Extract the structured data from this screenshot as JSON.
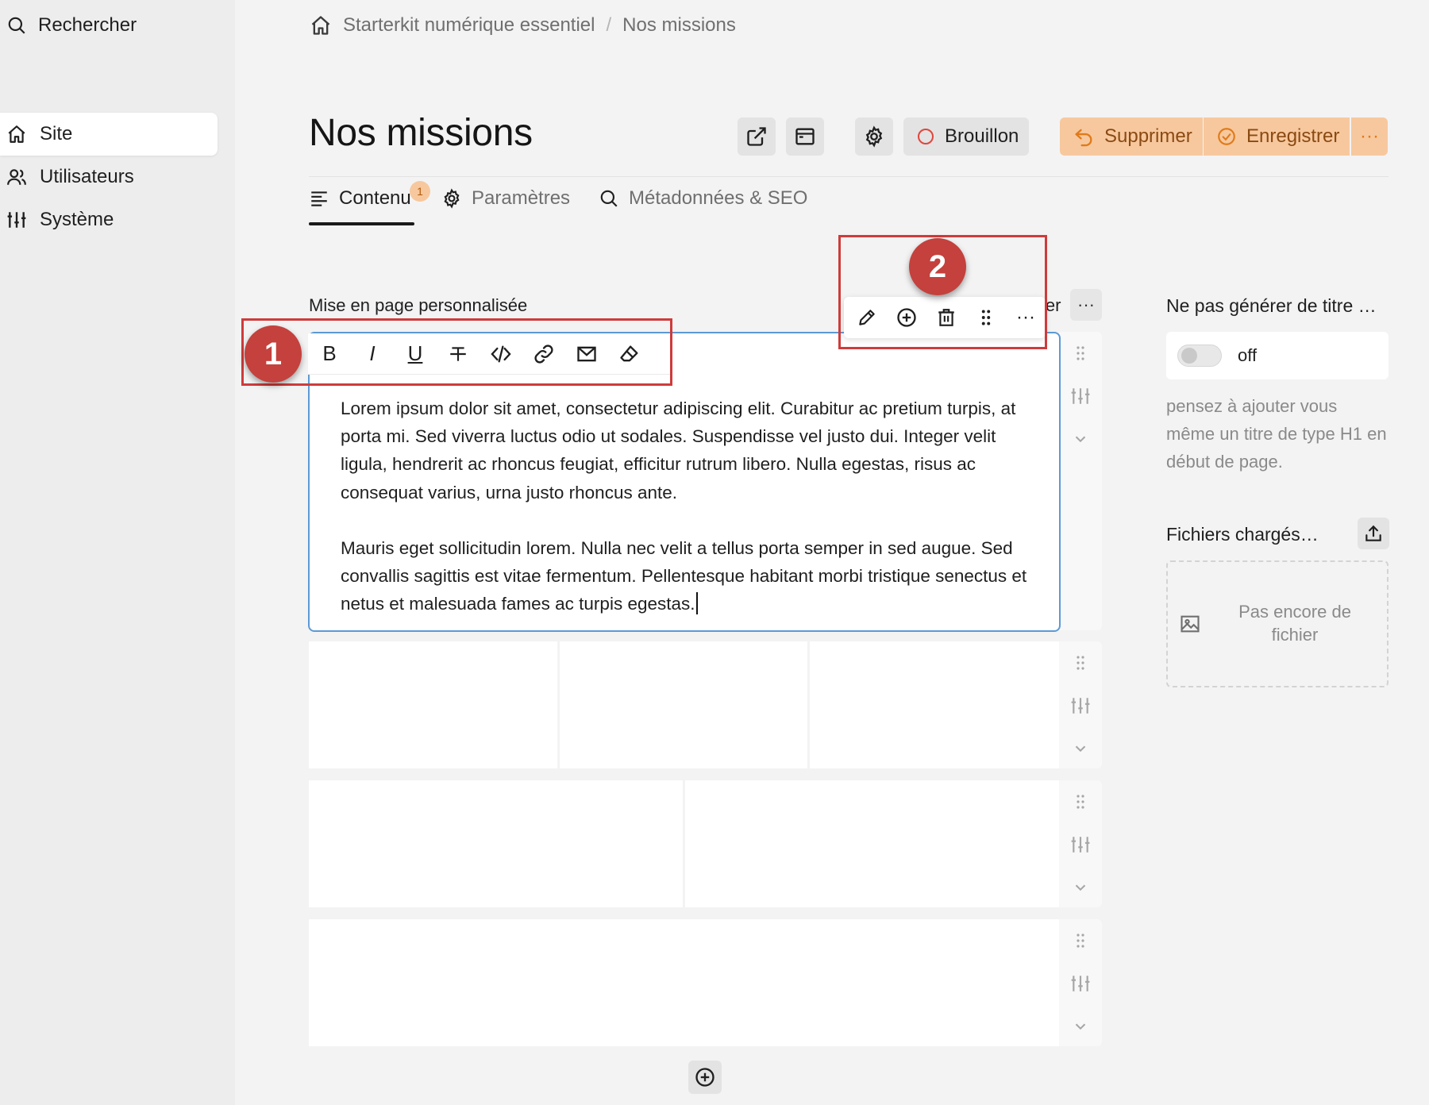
{
  "sidebar": {
    "search_label": "Rechercher",
    "items": [
      {
        "label": "Site",
        "icon": "home-icon",
        "active": true
      },
      {
        "label": "Utilisateurs",
        "icon": "users-icon",
        "active": false
      },
      {
        "label": "Système",
        "icon": "sliders-icon",
        "active": false
      }
    ]
  },
  "breadcrumb": {
    "items": [
      "Starterkit numérique essentiel",
      "Nos missions"
    ],
    "separator": "/"
  },
  "header": {
    "title": "Nos missions",
    "status_label": "Brouillon",
    "delete_label": "Supprimer",
    "save_label": "Enregistrer",
    "more_label": "···"
  },
  "tabs": [
    {
      "label": "Contenu",
      "badge": "1",
      "active": true
    },
    {
      "label": "Paramètres",
      "active": false
    },
    {
      "label": "Métadonnées & SEO",
      "active": false
    }
  ],
  "editor": {
    "section_label": "Mise en page personnalisée",
    "hidden_label": "ler",
    "section_more": "···",
    "format_toolbar": [
      "bold",
      "italic",
      "underline",
      "strikethrough",
      "code",
      "link",
      "email",
      "clear-format"
    ],
    "format_glyphs": {
      "bold": "B",
      "italic": "I",
      "underline": "U"
    },
    "block_toolbar": [
      "edit",
      "add",
      "delete",
      "drag",
      "more"
    ],
    "block_more": "···",
    "paragraphs": [
      "Lorem ipsum dolor sit amet, consectetur adipiscing elit. Curabitur ac pretium turpis, at porta mi. Sed viverra luctus odio ut sodales. Suspendisse vel justo dui. Integer velit ligula, hendrerit ac rhoncus feugiat, efficitur rutrum libero. Nulla egestas, risus ac consequat varius, urna justo rhoncus ante.",
      "Mauris eget sollicitudin lorem. Nulla nec velit a tellus porta semper in sed augue. Sed convallis sagittis est vitae fermentum. Pellentesque habitant morbi tristique senectus et netus et malesuada fames ac turpis egestas."
    ]
  },
  "annotations": [
    "1",
    "2"
  ],
  "right_panel": {
    "title_option_label": "Ne pas générer de titre …",
    "toggle_state": "off",
    "hint": "pensez à ajouter vous même un titre de type H1 en début de page.",
    "files_label": "Fichiers chargés…",
    "empty_files_label": "Pas encore de fichier"
  },
  "colors": {
    "accent_orange": "#f7c89e",
    "focus_blue": "#5b9ad6",
    "annotation_red": "#c4413d"
  }
}
